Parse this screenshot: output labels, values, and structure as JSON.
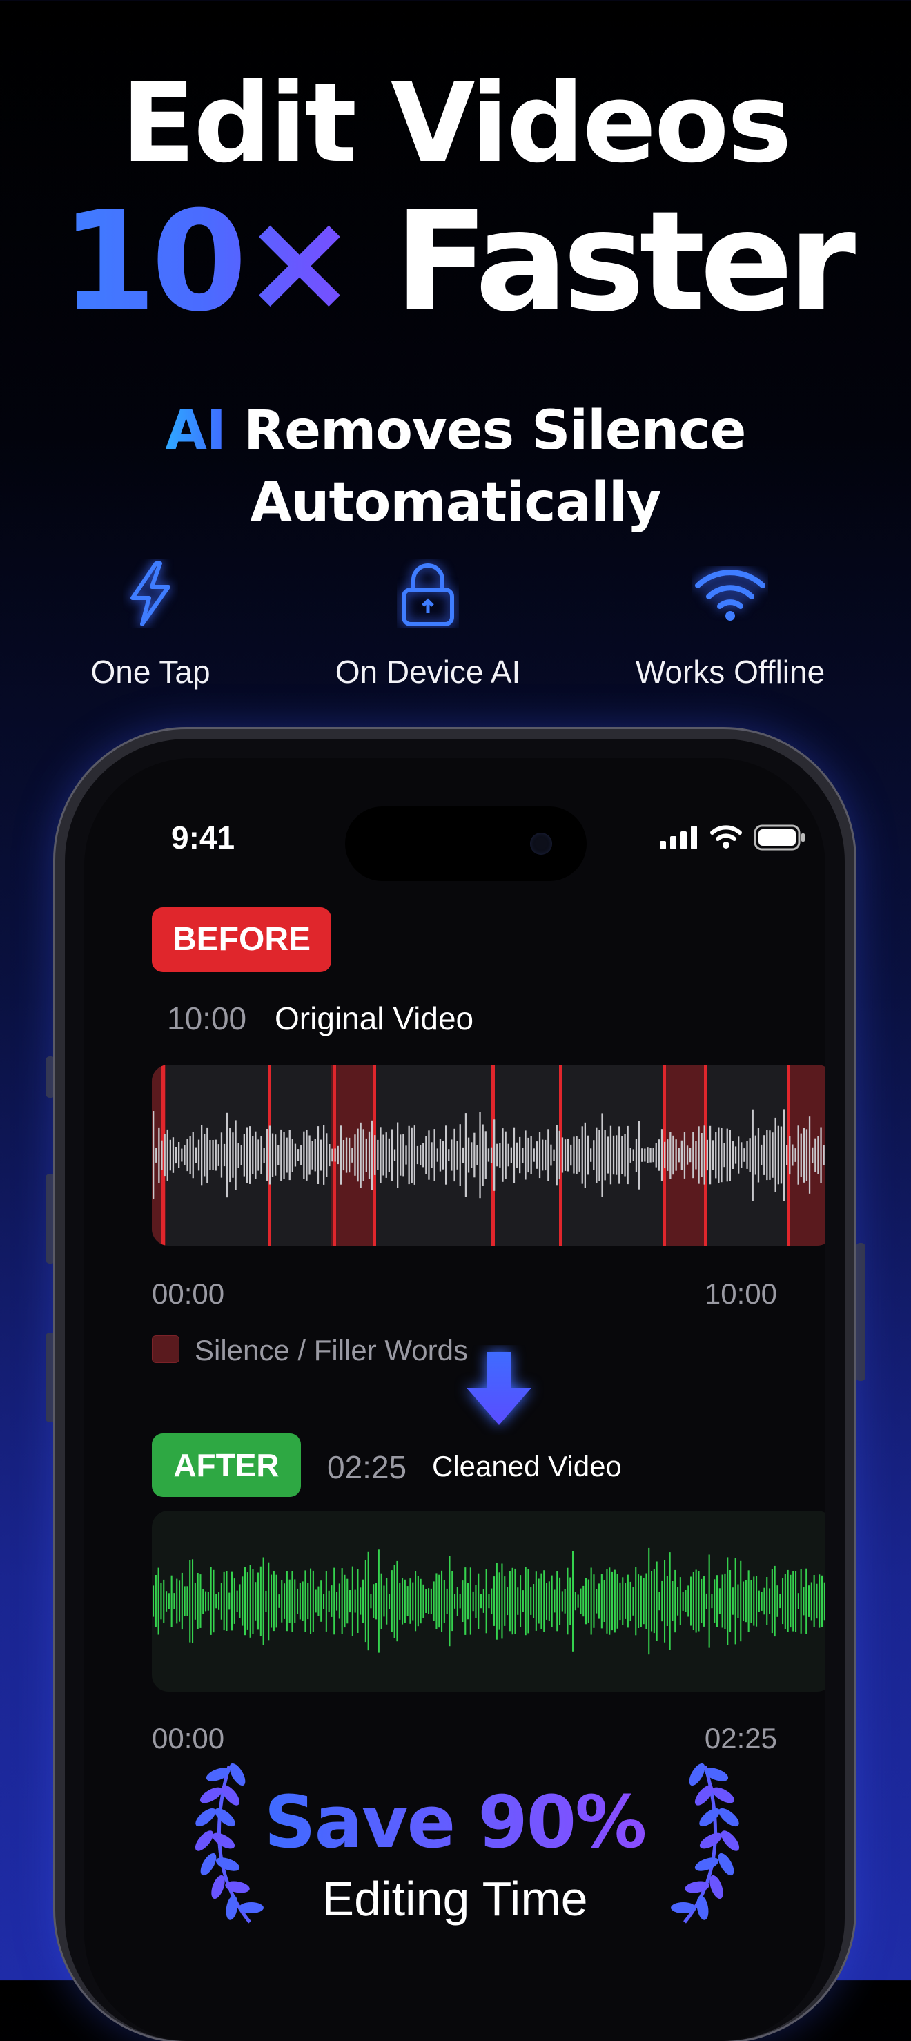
{
  "hero": {
    "line1": "Edit Videos",
    "line2_highlight": "10×",
    "line2_rest": "Faster",
    "sub_ai": "AI",
    "sub_line1_rest": "Removes Silence",
    "sub_line2": "Automatically"
  },
  "features": [
    {
      "label": "One Tap",
      "icon": "lightning-icon"
    },
    {
      "label": "On Device AI",
      "icon": "lock-icon"
    },
    {
      "label": "Works Offline",
      "icon": "wifi-icon"
    }
  ],
  "phone": {
    "status_time": "9:41",
    "before": {
      "badge": "BEFORE",
      "duration": "10:00",
      "title": "Original Video",
      "start": "00:00",
      "end": "10:00",
      "legend": "Silence / Filler Words"
    },
    "after": {
      "badge": "AFTER",
      "duration": "02:25",
      "title": "Cleaned Video",
      "start": "00:00",
      "end": "02:25"
    },
    "promo": {
      "headline": "Save 90%",
      "subline": "Editing Time"
    }
  },
  "colors": {
    "accent_blue": "#3f6bff",
    "accent_purple": "#7a4dff",
    "before_red": "#e0262c",
    "after_green": "#2ea843",
    "wave_gray": "#c8c8cc",
    "wave_green": "#35d24e"
  }
}
